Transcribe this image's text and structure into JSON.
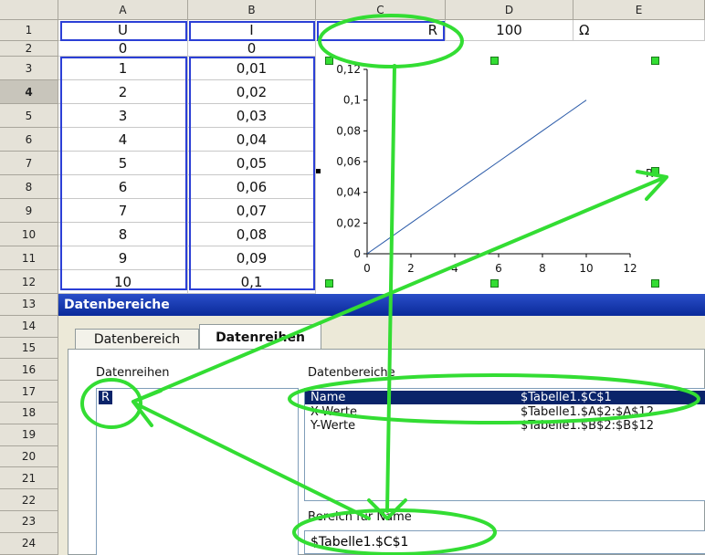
{
  "columns": [
    "A",
    "B",
    "C",
    "D",
    "E"
  ],
  "rows": [
    "1",
    "2",
    "3",
    "4",
    "5",
    "6",
    "7",
    "8",
    "9",
    "10",
    "11",
    "12",
    "13",
    "14",
    "15",
    "16",
    "17",
    "18",
    "19",
    "20",
    "21",
    "22",
    "23",
    "24"
  ],
  "row1": {
    "a": "U",
    "b": "I",
    "c": "R",
    "d": "100",
    "e": "Ω"
  },
  "col_a": [
    "0",
    "1",
    "2",
    "3",
    "4",
    "5",
    "6",
    "7",
    "8",
    "9",
    "10"
  ],
  "col_b": [
    "0",
    "0,01",
    "0,02",
    "0,03",
    "0,04",
    "0,05",
    "0,06",
    "0,07",
    "0,08",
    "0,09",
    "0,1"
  ],
  "chart": {
    "y_ticks": [
      "0,12",
      "0,1",
      "0,08",
      "0,06",
      "0,04",
      "0,02",
      "0"
    ],
    "x_ticks": [
      "0",
      "2",
      "4",
      "6",
      "8",
      "10",
      "12"
    ],
    "legend": "R"
  },
  "chart_data": {
    "type": "line",
    "x": [
      0,
      1,
      2,
      3,
      4,
      5,
      6,
      7,
      8,
      9,
      10
    ],
    "series": [
      {
        "name": "R",
        "values": [
          0,
          0.01,
          0.02,
          0.03,
          0.04,
          0.05,
          0.06,
          0.07,
          0.08,
          0.09,
          0.1
        ]
      }
    ],
    "xlim": [
      0,
      12
    ],
    "ylim": [
      0,
      0.12
    ],
    "legend": "right",
    "grid": false
  },
  "dialog": {
    "title": "Datenbereiche",
    "tabs": [
      "Datenbereich",
      "Datenreihen"
    ],
    "series_label": "Datenreihen",
    "series_items": [
      "R"
    ],
    "ranges_label": "Datenbereiche",
    "ranges": [
      {
        "name": "Name",
        "range": "$Tabelle1.$C$1"
      },
      {
        "name": "X-Werte",
        "range": "$Tabelle1.$A$2:$A$12"
      },
      {
        "name": "Y-Werte",
        "range": "$Tabelle1.$B$2:$B$12"
      }
    ],
    "range_for_label": "Bereich für Name",
    "range_for_value": "$Tabelle1.$C$1"
  },
  "colors": {
    "annotation": "#33dd33",
    "highlight": "#2b3fd6",
    "selection": "#0a246a",
    "titlebar": "#0a2a9a"
  }
}
